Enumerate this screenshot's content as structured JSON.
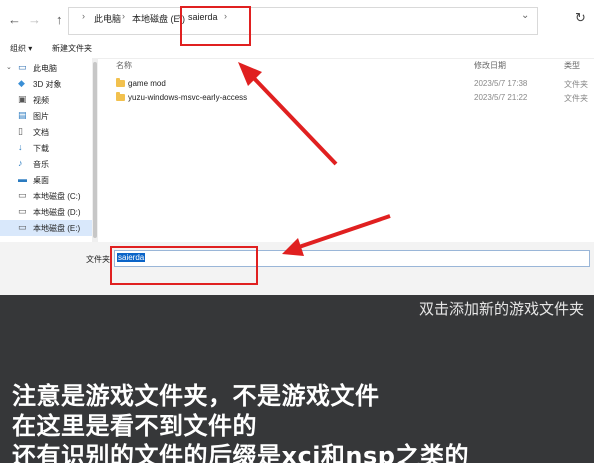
{
  "nav": {
    "back": "←",
    "forward": "→",
    "up": "↑",
    "refresh": "↻"
  },
  "breadcrumb": [
    "此电脑",
    "本地磁盘 (E:)",
    "saierda"
  ],
  "toolbar": {
    "organize": "组织 ▾",
    "new_folder": "新建文件夹"
  },
  "sidebar": [
    {
      "label": "此电脑",
      "icon": "computer-icon"
    },
    {
      "label": "3D 对象",
      "icon": "cube-icon"
    },
    {
      "label": "视频",
      "icon": "video-icon"
    },
    {
      "label": "图片",
      "icon": "picture-icon"
    },
    {
      "label": "文档",
      "icon": "document-icon"
    },
    {
      "label": "下载",
      "icon": "download-icon"
    },
    {
      "label": "音乐",
      "icon": "music-icon"
    },
    {
      "label": "桌面",
      "icon": "desktop-icon"
    },
    {
      "label": "本地磁盘 (C:)",
      "icon": "drive-icon"
    },
    {
      "label": "本地磁盘 (D:)",
      "icon": "drive-icon"
    },
    {
      "label": "本地磁盘 (E:)",
      "icon": "drive-icon"
    }
  ],
  "columns": {
    "name": "名称",
    "date": "修改日期",
    "type": "类型"
  },
  "files": [
    {
      "name": "game mod",
      "date": "2023/5/7 17:38",
      "type": "文件夹"
    },
    {
      "name": "yuzu-windows-msvc-early-access",
      "date": "2023/5/7 21:22",
      "type": "文件夹"
    }
  ],
  "folder_field": {
    "label": "文件夹:",
    "value": "saierda"
  },
  "captions": {
    "subtitle": "双击添加新的游戏文件夹",
    "line1": "注意是游戏文件夹，不是游戏文件",
    "line2": "在这里是看不到文件的",
    "line3": "还有识别的文件的后缀是xci和nsp之类的"
  },
  "colors": {
    "annotation": "#e02020",
    "selection": "#0a64c8",
    "caption_bg": "#363739"
  }
}
